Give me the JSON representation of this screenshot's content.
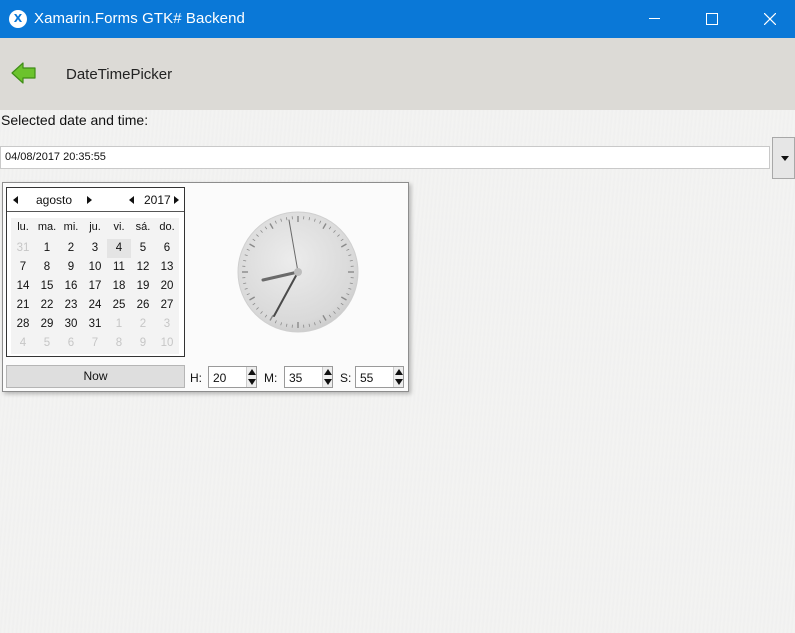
{
  "window": {
    "title": "Xamarin.Forms GTK# Backend",
    "icon": "xamarin-icon",
    "controls": [
      "minimize-icon",
      "maximize-icon",
      "close-icon"
    ]
  },
  "navbar": {
    "back_icon": "back-arrow-icon",
    "title": "DateTimePicker"
  },
  "content": {
    "label": "Selected date and time:",
    "input_value": "04/08/2017 20:35:55",
    "dropdown_icon": "dropdown-arrow-icon"
  },
  "calendar": {
    "month": "agosto",
    "year": "2017",
    "weekdays": [
      "lu.",
      "ma.",
      "mi.",
      "ju.",
      "vi.",
      "sá.",
      "do."
    ],
    "weeks": [
      [
        "31",
        "1",
        "2",
        "3",
        "4",
        "5",
        "6"
      ],
      [
        "7",
        "8",
        "9",
        "10",
        "11",
        "12",
        "13"
      ],
      [
        "14",
        "15",
        "16",
        "17",
        "18",
        "19",
        "20"
      ],
      [
        "21",
        "22",
        "23",
        "24",
        "25",
        "26",
        "27"
      ],
      [
        "28",
        "29",
        "30",
        "31",
        "1",
        "2",
        "3"
      ],
      [
        "4",
        "5",
        "6",
        "7",
        "8",
        "9",
        "10"
      ]
    ],
    "selected_day": "4",
    "now_label": "Now"
  },
  "time": {
    "hour_label": "H:",
    "hour": "20",
    "minute_label": "M:",
    "minute": "35",
    "second_label": "S:",
    "second": "55"
  },
  "colors": {
    "titlebar": "#0a78d7",
    "navbar": "#dcdad6",
    "back_arrow": "#6cc32d"
  }
}
